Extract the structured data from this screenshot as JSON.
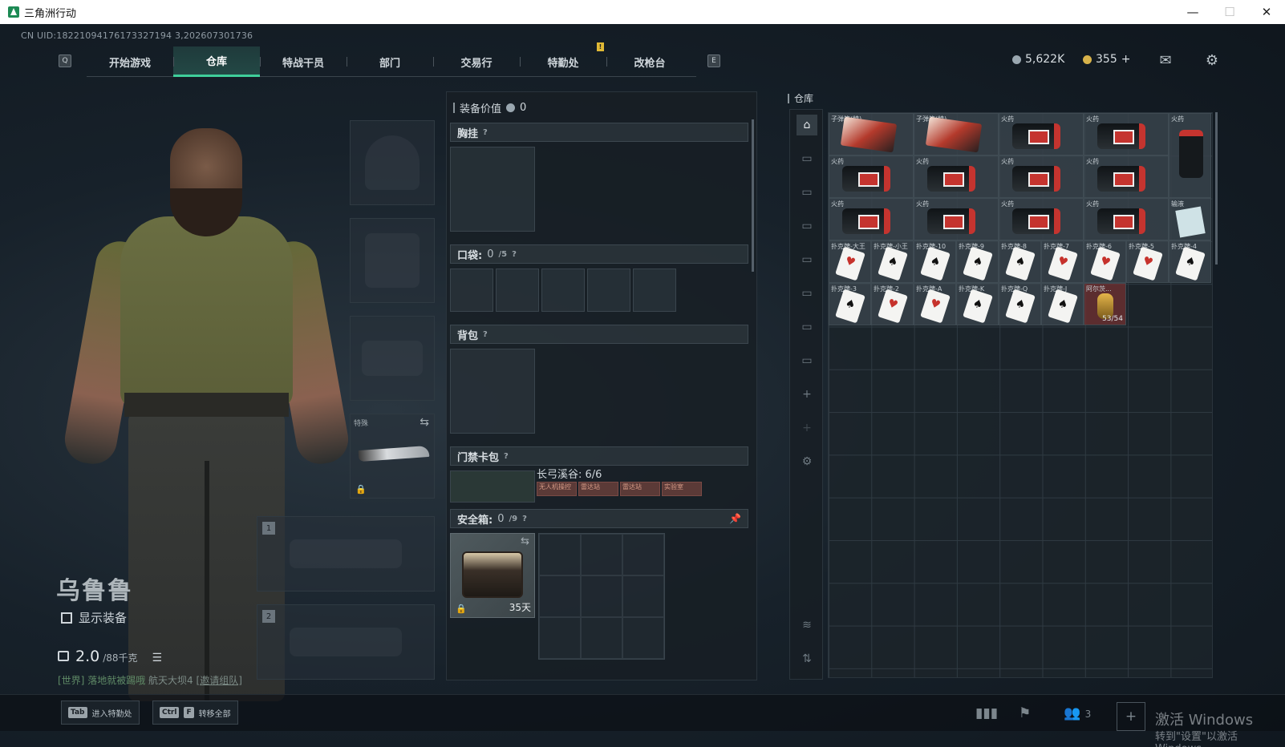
{
  "window": {
    "title": "三角洲行动",
    "minimize": "—",
    "maximize": "☐",
    "close": "✕"
  },
  "uid": "CN UID:18221094176173327194 3,202607301736",
  "nav": {
    "left_key": "Q",
    "right_key": "E",
    "tabs": [
      "开始游戏",
      "仓库",
      "特战干员",
      "部门",
      "交易行",
      "特勤处",
      "改枪台"
    ],
    "active_index": 1,
    "notice": "!"
  },
  "currency": {
    "coins": "5,622K",
    "gold": "355",
    "plus": "+",
    "coin_color": "#9aa7b0",
    "gold_color": "#d7b24a"
  },
  "header_icons": {
    "mail": "mail-icon",
    "settings": "gear-icon"
  },
  "player": {
    "name": "乌鲁鲁",
    "show_gear_label": "显示装备",
    "weight_value": "2.0",
    "weight_unit": "/88千克"
  },
  "chat": {
    "channel": "[世界]",
    "author": "落地就被踢哦",
    "message": "航天大坝4",
    "join": "[邀请组队]"
  },
  "melee": {
    "label": "特殊"
  },
  "weapon_slots": [
    "1",
    "2"
  ],
  "loadout": {
    "equip_value_label": "装备价值",
    "equip_value": "0",
    "chest_label": "胸挂",
    "pocket_label": "口袋:",
    "pocket_count": "0",
    "pocket_max": "/5",
    "backpack_label": "背包",
    "keycard_label": "门禁卡包",
    "access_text": "长弓溪谷: 6/6",
    "cards": [
      "无人机操控",
      "雷达站",
      "雷达站",
      "实验室"
    ],
    "safe_label": "安全箱:",
    "safe_count": "0",
    "safe_max": "/9",
    "safe_days": "35天",
    "help": "?"
  },
  "stash": {
    "label": "仓库",
    "row1": [
      {
        "label": "子弹箱(特)",
        "type": "ticket"
      },
      {
        "label": "子弹箱(特)",
        "type": "ticket"
      },
      {
        "label": "火药",
        "type": "jar"
      },
      {
        "label": "火药",
        "type": "jar"
      },
      {
        "label": "火药",
        "type": "tall"
      }
    ],
    "row2": [
      {
        "label": "火药",
        "type": "jar"
      },
      {
        "label": "火药",
        "type": "jar"
      },
      {
        "label": "火药",
        "type": "jar"
      },
      {
        "label": "火药",
        "type": "jar"
      }
    ],
    "row3": [
      {
        "label": "火药",
        "type": "jar"
      },
      {
        "label": "火药",
        "type": "jar"
      },
      {
        "label": "火药",
        "type": "jar"
      },
      {
        "label": "火药",
        "type": "jar"
      },
      {
        "label": "输液",
        "type": "small"
      }
    ],
    "row4": [
      "扑克牌-大王",
      "扑克牌-小王",
      "扑克牌-10",
      "扑克牌-9",
      "扑克牌-8",
      "扑克牌-7",
      "扑克牌-6",
      "扑克牌-5",
      "扑克牌-4"
    ],
    "row5": [
      "扑克牌-3",
      "扑克牌-2",
      "扑克牌-A",
      "扑克牌-K",
      "扑克牌-Q",
      "扑克牌-J",
      "阿尔茨..."
    ],
    "special_qty": "53/54"
  },
  "bottom": {
    "tab_key": "Tab",
    "tab_label": "进入特勤处",
    "ctrl_key": "Ctrl",
    "f_key": "F",
    "transfer_label": "转移全部",
    "friends_count": "3"
  },
  "watermark": {
    "line1": "激活 Windows",
    "line2": "转到\"设置\"以激活 Windows"
  }
}
